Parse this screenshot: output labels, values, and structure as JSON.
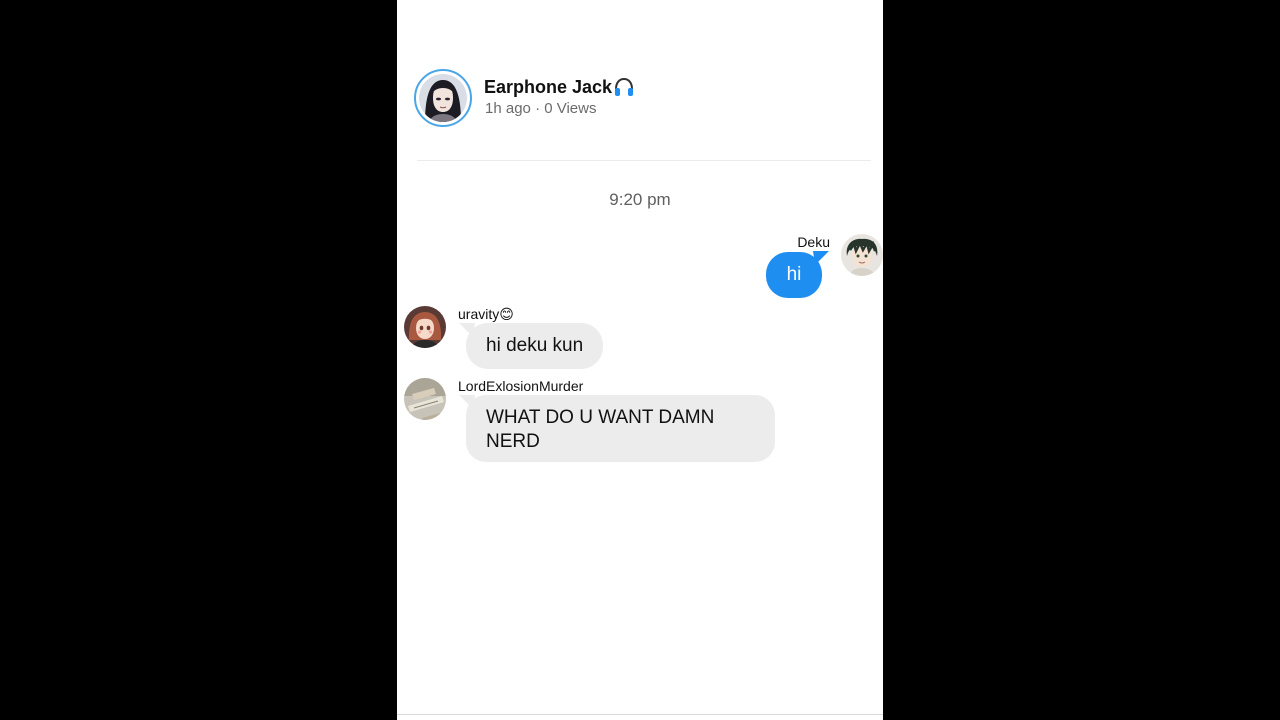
{
  "post": {
    "author": "Earphone Jack",
    "author_icon": "headphones-icon",
    "age": "1h ago",
    "separator": "·",
    "views": "0 Views"
  },
  "chat": {
    "timestamp": "9:20 pm",
    "messages": [
      {
        "sender": "Deku",
        "text": "hi",
        "direction": "outgoing"
      },
      {
        "sender": "uravity😊",
        "text": "hi deku kun",
        "direction": "incoming"
      },
      {
        "sender": "LordExlosionMurder",
        "text": "WHAT DO U WANT DAMN NERD",
        "direction": "incoming"
      }
    ]
  },
  "colors": {
    "outgoing_bubble": "#1f8ef1",
    "incoming_bubble": "#ececec",
    "avatar_ring": "#4aa6e8"
  }
}
